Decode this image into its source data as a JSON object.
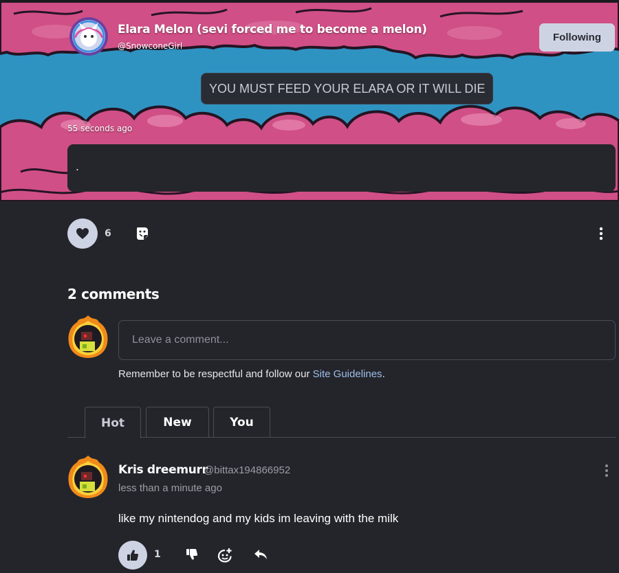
{
  "post": {
    "author_name": "Elara Melon (sevi forced me to become a melon)",
    "author_handle": "@SnowconeGirl",
    "follow_label": "Following",
    "title": "YOU MUST FEED YOUR ELARA OR IT WILL DIE",
    "timestamp": "55 seconds ago",
    "body": ".",
    "like_count": "6",
    "liked": true
  },
  "comments_section": {
    "heading": "2 comments",
    "input_placeholder": "Leave a comment...",
    "input_value": "",
    "guidelines_prefix": "Remember to be respectful and follow our ",
    "guidelines_link": "Site Guidelines",
    "guidelines_suffix": ".",
    "tabs": [
      {
        "label": "Hot",
        "active": true
      },
      {
        "label": "New",
        "active": false
      },
      {
        "label": "You",
        "active": false
      }
    ]
  },
  "comments": [
    {
      "name": "Kris dreemurr",
      "handle": "@bittax194866952",
      "time": "less than a minute ago",
      "text": "like my nintendog and my kids im leaving with the milk",
      "like_count": "1"
    }
  ],
  "icons": {
    "like": "heart-icon",
    "sticker": "sticker-icon",
    "more": "more-vertical-icon",
    "thumbs_up": "thumbs-up-icon",
    "thumbs_down": "thumbs-down-icon",
    "add_sticker": "add-sticker-icon",
    "reply": "reply-icon"
  },
  "colors": {
    "background": "#24252b",
    "banner_sky": "#2f93c2",
    "banner_cloud": "#d04f86",
    "button_light": "#ced3e4",
    "link": "#9fbfea"
  }
}
